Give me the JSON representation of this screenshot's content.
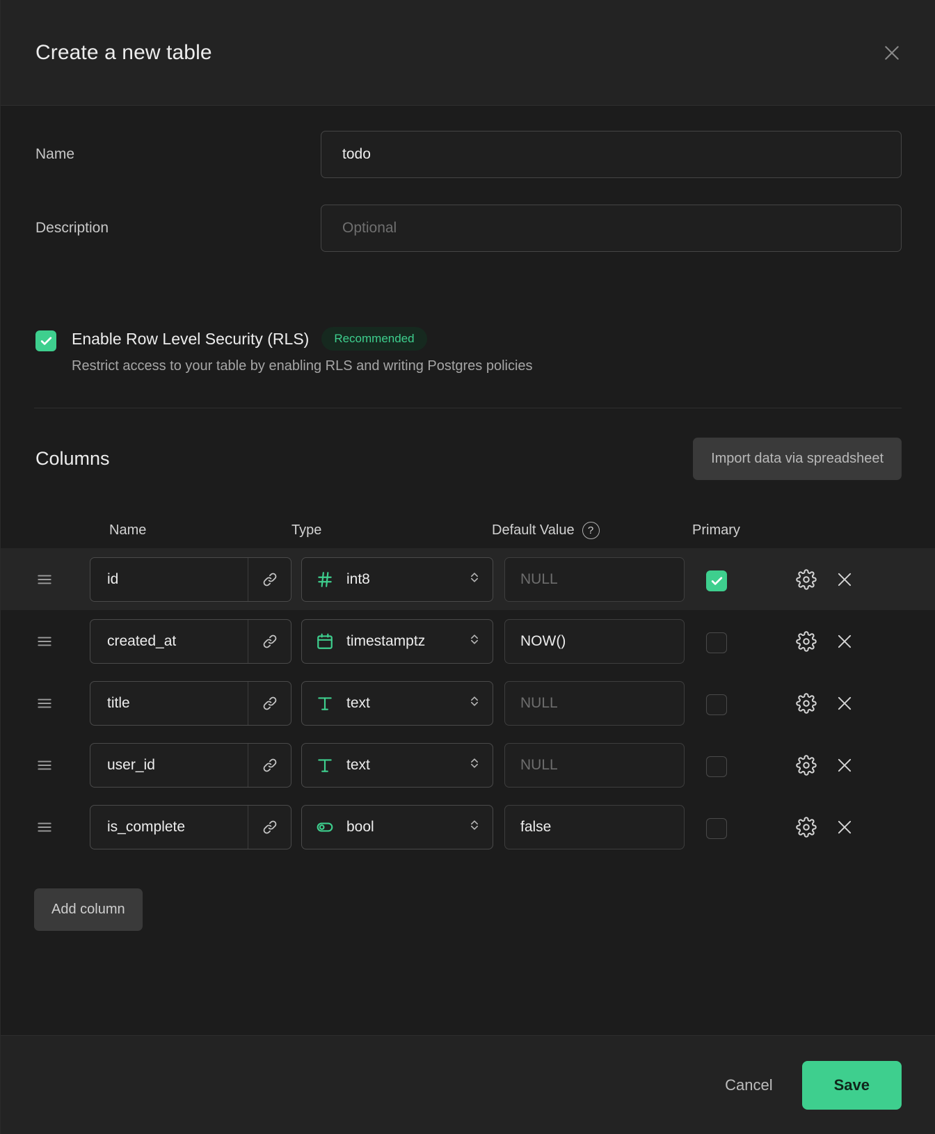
{
  "header": {
    "title": "Create a new table",
    "close_icon": "close-icon"
  },
  "form": {
    "name_label": "Name",
    "name_value": "todo",
    "description_label": "Description",
    "description_placeholder": "Optional"
  },
  "rls": {
    "checked": true,
    "title": "Enable Row Level Security (RLS)",
    "badge": "Recommended",
    "description": "Restrict access to your table by enabling RLS and writing Postgres policies"
  },
  "columns_section": {
    "title": "Columns",
    "import_label": "Import data via spreadsheet",
    "add_column_label": "Add column",
    "headers": {
      "name": "Name",
      "type": "Type",
      "default_value": "Default Value",
      "help_glyph": "?",
      "primary": "Primary"
    },
    "rows": [
      {
        "name": "id",
        "type": "int8",
        "type_icon": "hash-icon",
        "default": "NULL",
        "default_is_placeholder": true,
        "primary": true,
        "highlight": true
      },
      {
        "name": "created_at",
        "type": "timestamptz",
        "type_icon": "calendar-icon",
        "default": "NOW()",
        "default_is_placeholder": false,
        "primary": false,
        "highlight": false
      },
      {
        "name": "title",
        "type": "text",
        "type_icon": "text-icon",
        "default": "NULL",
        "default_is_placeholder": true,
        "primary": false,
        "highlight": false
      },
      {
        "name": "user_id",
        "type": "text",
        "type_icon": "text-icon",
        "default": "NULL",
        "default_is_placeholder": true,
        "primary": false,
        "highlight": false
      },
      {
        "name": "is_complete",
        "type": "bool",
        "type_icon": "toggle-icon",
        "default": "false",
        "default_is_placeholder": false,
        "primary": false,
        "highlight": false
      }
    ]
  },
  "footer": {
    "cancel_label": "Cancel",
    "save_label": "Save"
  },
  "colors": {
    "accent_green": "#3ecf8e",
    "badge_bg": "#16291f",
    "panel_bg": "#1c1c1c",
    "header_bg": "#232323"
  }
}
